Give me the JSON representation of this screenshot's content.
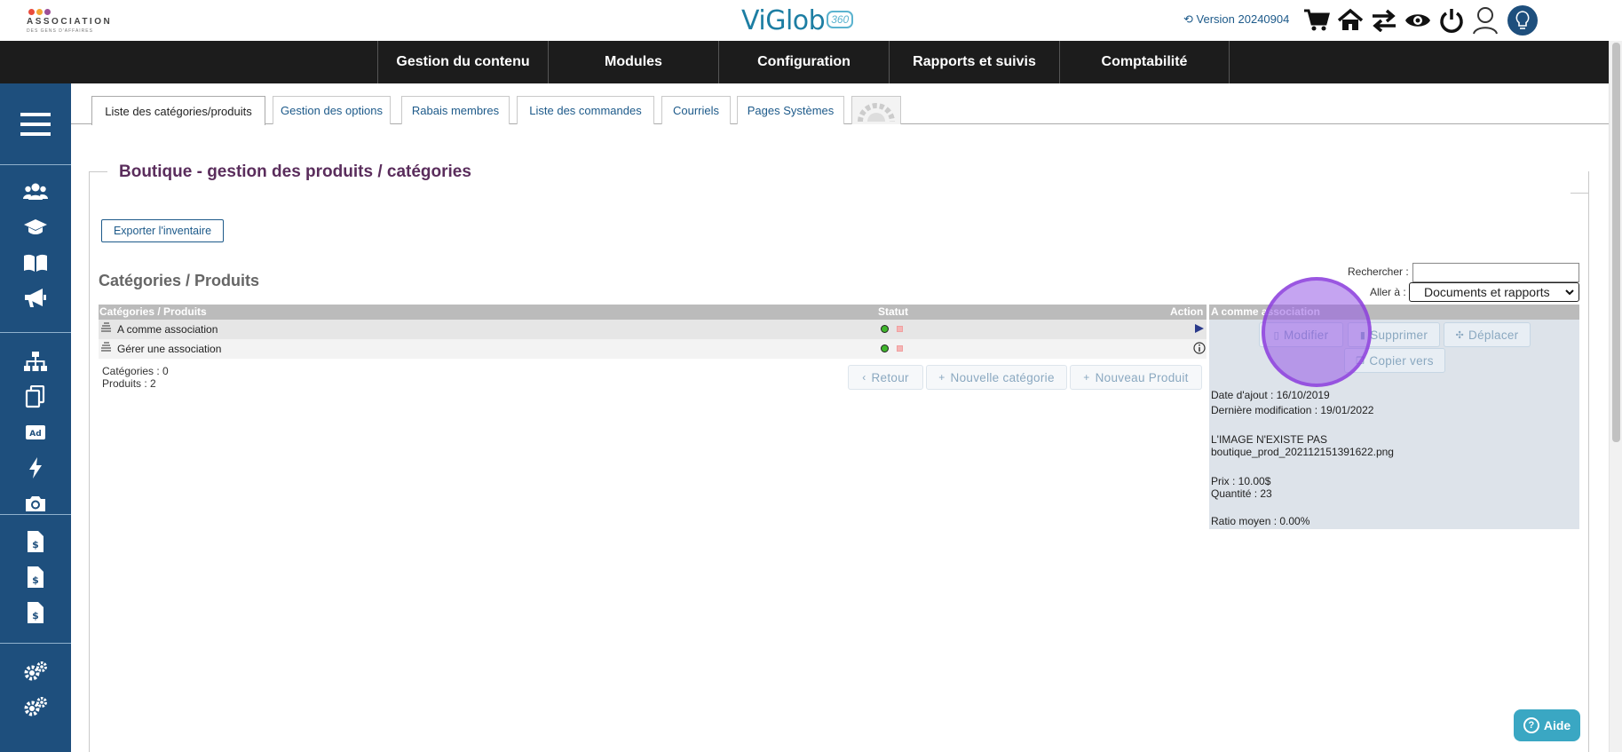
{
  "header": {
    "logo_name": "ASSOCIATION",
    "logo_sub": "DES GENS D'AFFAIRES",
    "brand": "ViGlob",
    "brand_badge": "360",
    "version": "Version 20240904",
    "icons": [
      "history-icon",
      "cart-icon",
      "home-icon",
      "swap-icon",
      "eye-icon",
      "power-icon",
      "user-icon",
      "avatar-icon"
    ]
  },
  "mainnav": {
    "items": [
      "Gestion du contenu",
      "Modules",
      "Configuration",
      "Rapports et suivis",
      "Comptabilité"
    ]
  },
  "sidebar": {
    "icons": [
      "menu-icon",
      "users-icon",
      "graduation-cap-icon",
      "book-icon",
      "megaphone-icon",
      "sitemap-icon",
      "copy-icon",
      "ad-icon",
      "bolt-icon",
      "camera-icon",
      "invoice-icon",
      "invoice-icon",
      "invoice-icon",
      "cogs-icon",
      "cogs-icon"
    ],
    "color": "#1e4f7d"
  },
  "tabs": [
    "Liste des catégories/produits",
    "Gestion des options",
    "Rabais membres",
    "Liste des commandes",
    "Courriels",
    "Pages Systèmes"
  ],
  "page": {
    "title": "Boutique - gestion des produits / catégories",
    "export_label": "Exporter l'inventaire",
    "section_title": "Catégories / Produits",
    "search_label": "Rechercher :",
    "search_value": "",
    "goto_label": "Aller à :",
    "goto_value": "Documents et rapports"
  },
  "table": {
    "headers": {
      "name": "Catégories / Produits",
      "status": "Statut",
      "action": "Action"
    },
    "rows": [
      {
        "label": "A comme association"
      },
      {
        "label": "Gérer une association"
      }
    ],
    "counts": {
      "categories": "Catégories : 0",
      "products": "Produits : 2"
    },
    "buttons": {
      "back": "Retour",
      "new_category": "Nouvelle catégorie",
      "new_product": "Nouveau Produit"
    }
  },
  "detail": {
    "title": "A comme association",
    "buttons": {
      "edit": "Modifier",
      "delete": "Supprimer",
      "move": "Déplacer",
      "copy": "Copier vers"
    },
    "date_added": "Date d'ajout : 16/10/2019",
    "last_modified": "Dernière modification : 19/01/2022",
    "image_missing": "L'IMAGE N'EXISTE PAS",
    "image_file": "boutique_prod_202112151391622.png",
    "price": "Prix : 10.00$",
    "quantity": "Quantité : 23",
    "ratio": "Ratio moyen : 0.00%"
  },
  "help": {
    "label": "Aide"
  },
  "colors": {
    "accent": "#1d5a8a",
    "title": "#5a2d5c",
    "nav": "#1c1c1c",
    "highlight": "#9b5de5",
    "help": "#3aa7c3"
  }
}
